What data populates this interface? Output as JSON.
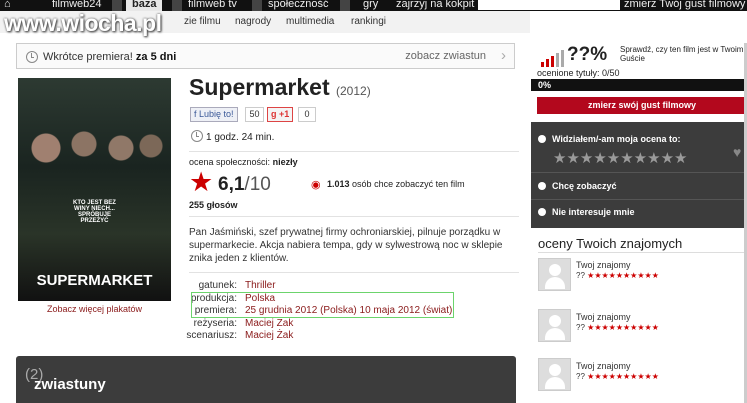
{
  "topnav": {
    "items": [
      "filmweb24",
      "baza",
      "filmweb tv",
      "społeczność",
      "gry",
      "zajrzyj na kokpit",
      "zmierz Twój gust filmowy"
    ]
  },
  "logo": "www.wiocha.pl",
  "subnav": [
    "zie filmu",
    "nagrody",
    "multimedia",
    "rankingi"
  ],
  "premiere": {
    "label": "Wkrótce premiera!",
    "days": "za 5 dni",
    "link": "zobacz zwiastun"
  },
  "poster": {
    "tagline": "KTO JEST BEZ WINY NIECH... SPRÓBUJE PRZEŻYĆ",
    "title": "SUPERMARKET",
    "link": "Zobacz więcej plakatów"
  },
  "film": {
    "title": "Supermarket",
    "year": "(2012)",
    "like": "Lubię to!",
    "like_count": "50",
    "gplus": "+1",
    "gplus_count": "0",
    "duration": "1 godz. 24 min.",
    "community_label": "ocena społeczności:",
    "community_value": "niezły",
    "rating": "6,1",
    "rating_max": "/10",
    "votes": "255 głosów",
    "want_count": "1.013",
    "want_text": "osób chce zobaczyć ten film",
    "description": "Pan Jaśmiński, szef prywatnej firmy ochroniarskiej, pilnuje porządku w supermarkecie. Akcja nabiera tempa, gdy w sylwestrową noc w sklepie znika jeden z klientów."
  },
  "details": [
    {
      "k": "gatunek:",
      "v": "Thriller"
    },
    {
      "k": "produkcja:",
      "v": "Polska"
    },
    {
      "k": "premiera:",
      "v": "25 grudnia 2012 (Polska) 10 maja 2012 (świat)"
    },
    {
      "k": "reżyseria:",
      "v": "Maciej Żak"
    },
    {
      "k": "scenariusz:",
      "v": "Maciej Żak"
    }
  ],
  "trailers": {
    "label": "zwiastuny",
    "count": "(2)"
  },
  "meter": {
    "pct": "??%",
    "text": "Sprawdź, czy ten film jest w Twoim Guście",
    "rated": "ocenione tytuły: 0/50",
    "progress": "0%"
  },
  "gust_button": "zmierz swój gust filmowy",
  "options": {
    "seen": "Widziałem/-am moja ocena to:",
    "want": "Chcę zobaczyć",
    "notint": "Nie interesuje mnie"
  },
  "stars": "★★★★★★★★★★",
  "friends": {
    "heading": "oceny Twoich znajomych",
    "items": [
      {
        "name": "Twoj znajomy",
        "rating": "??",
        "stars": "★★★★★★★★★★"
      },
      {
        "name": "Twoj znajomy",
        "rating": "??",
        "stars": "★★★★★★★★★★"
      },
      {
        "name": "Twoj znajomy",
        "rating": "??",
        "stars": "★★★★★★★★★★"
      }
    ]
  }
}
